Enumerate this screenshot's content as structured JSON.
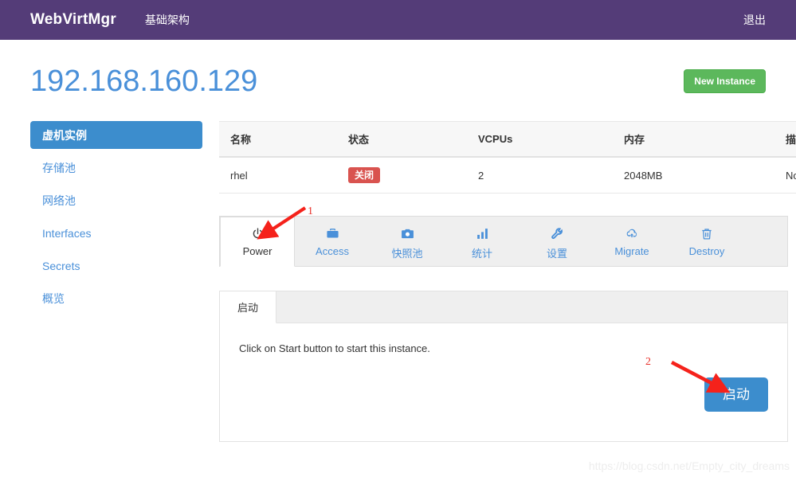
{
  "navbar": {
    "brand": "WebVirtMgr",
    "link_infrastructure": "基础架构",
    "logout": "退出"
  },
  "page": {
    "title": "192.168.160.129",
    "new_instance_button": "New Instance"
  },
  "sidebar": {
    "items": [
      {
        "label": "虚机实例",
        "active": true
      },
      {
        "label": "存储池",
        "active": false
      },
      {
        "label": "网络池",
        "active": false
      },
      {
        "label": "Interfaces",
        "active": false
      },
      {
        "label": "Secrets",
        "active": false
      },
      {
        "label": "概览",
        "active": false
      }
    ]
  },
  "instances_table": {
    "headers": [
      "名称",
      "状态",
      "VCPUs",
      "内存",
      "描述"
    ],
    "rows": [
      {
        "name": "rhel",
        "state": "关闭",
        "vcpus": "2",
        "memory": "2048MB",
        "description": "None"
      }
    ]
  },
  "tabs": [
    {
      "label": "Power",
      "icon": "power-icon",
      "active": true
    },
    {
      "label": "Access",
      "icon": "briefcase-icon",
      "active": false
    },
    {
      "label": "快照池",
      "icon": "camera-icon",
      "active": false
    },
    {
      "label": "统计",
      "icon": "bar-chart-icon",
      "active": false
    },
    {
      "label": "设置",
      "icon": "wrench-icon",
      "active": false
    },
    {
      "label": "Migrate",
      "icon": "cloud-download-icon",
      "active": false
    },
    {
      "label": "Destroy",
      "icon": "trash-icon",
      "active": false
    }
  ],
  "power_panel": {
    "tab_label": "启动",
    "message": "Click on Start button to start this instance.",
    "start_button": "启动"
  },
  "annotations": {
    "marker_1": "1",
    "marker_2": "2"
  },
  "watermark": "https://blog.csdn.net/Empty_city_dreams",
  "colors": {
    "navbar_purple": "#543C78",
    "accent_blue": "#3C8DCD",
    "title_blue": "#4a90d9",
    "success_green": "#5cb85c",
    "danger_red": "#d9534f",
    "annotation_red": "#e8312a"
  }
}
